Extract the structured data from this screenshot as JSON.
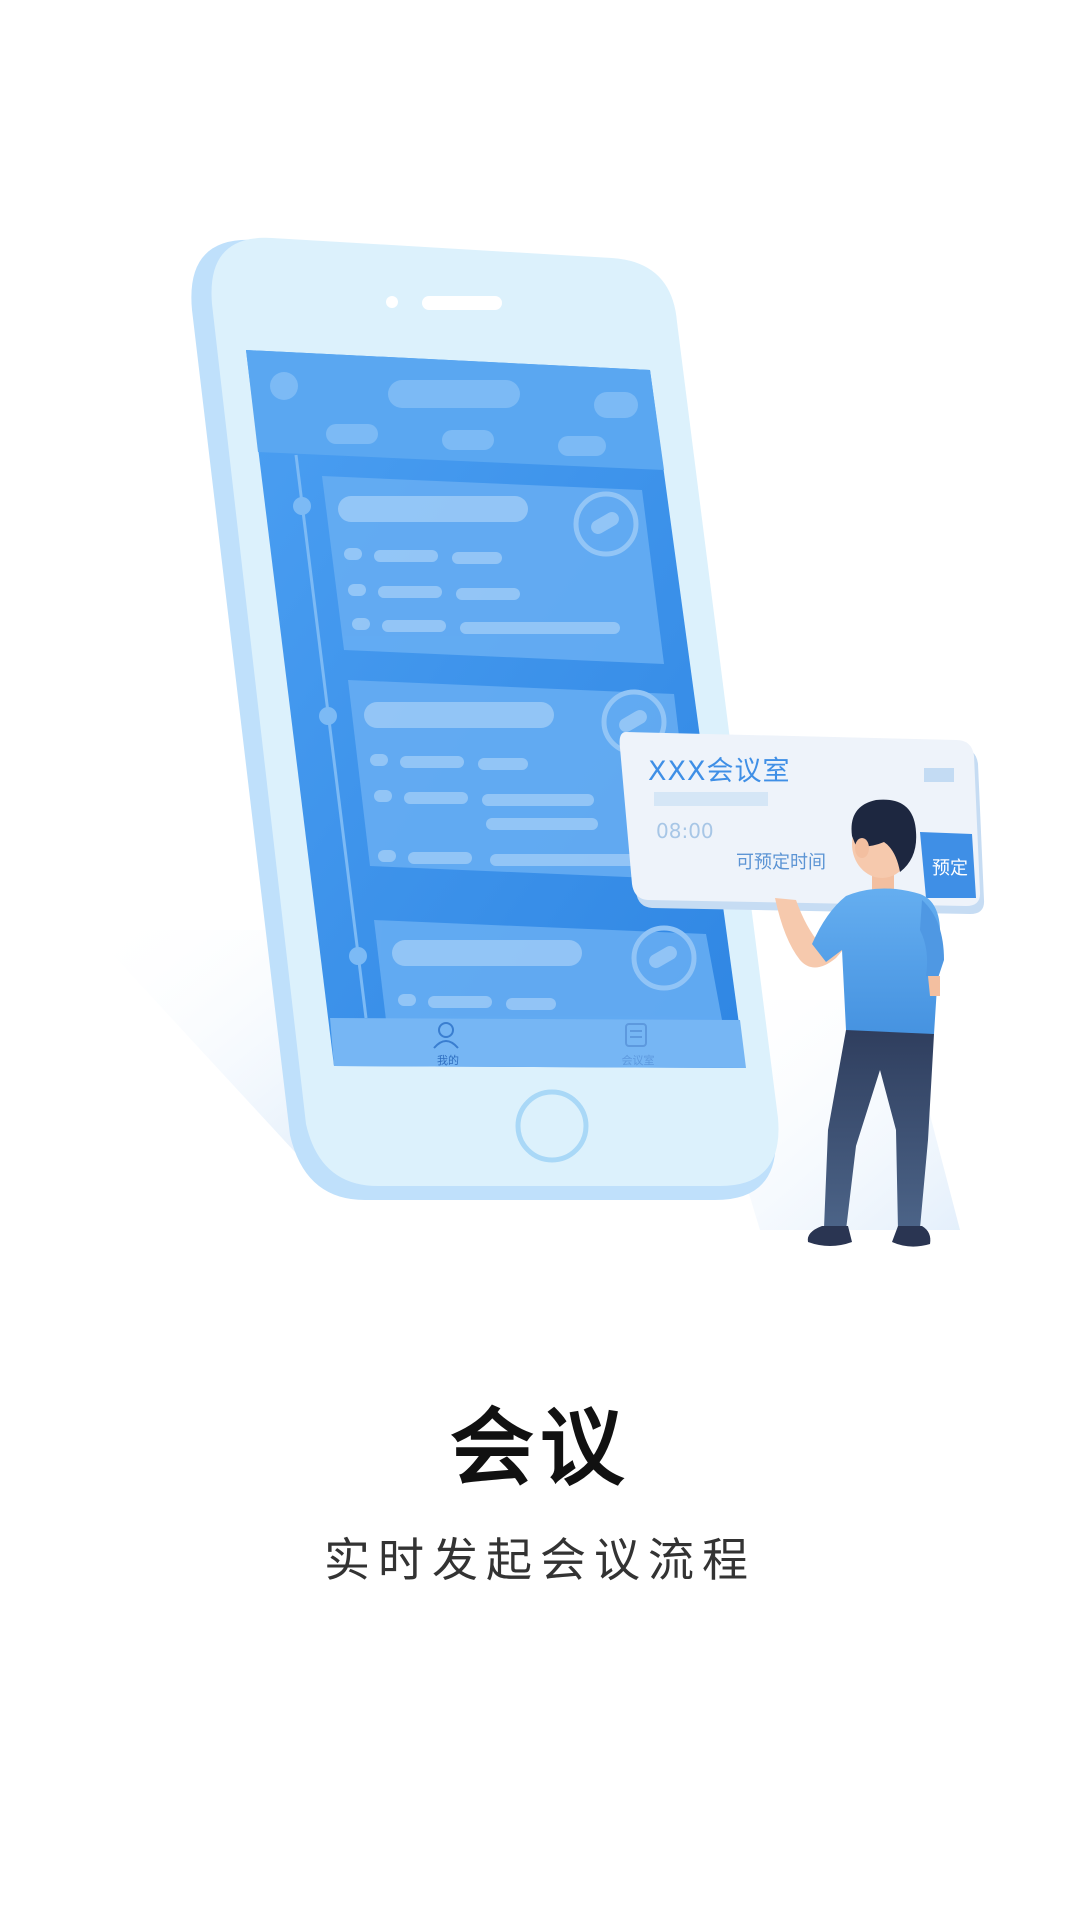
{
  "screen": {
    "title": "会议",
    "subtitle": "实时发起会议流程"
  },
  "illustration": {
    "card": {
      "room_name": "XXX会议室",
      "time": "08:00",
      "status_text": "可预定时间",
      "book_button": "预定"
    },
    "phone_tabs": [
      {
        "label": "我的",
        "icon": "person-icon"
      },
      {
        "label": "会议室",
        "icon": "document-icon"
      }
    ]
  },
  "colors": {
    "phone_frame": "#cfe7fb",
    "phone_screen": "#4a9cf0",
    "card_bg": "#eef3fa",
    "accent_blue": "#3f8fe6",
    "shirt": "#5aa3ea",
    "pants": "#3a4d6e",
    "hair": "#1d2740"
  }
}
